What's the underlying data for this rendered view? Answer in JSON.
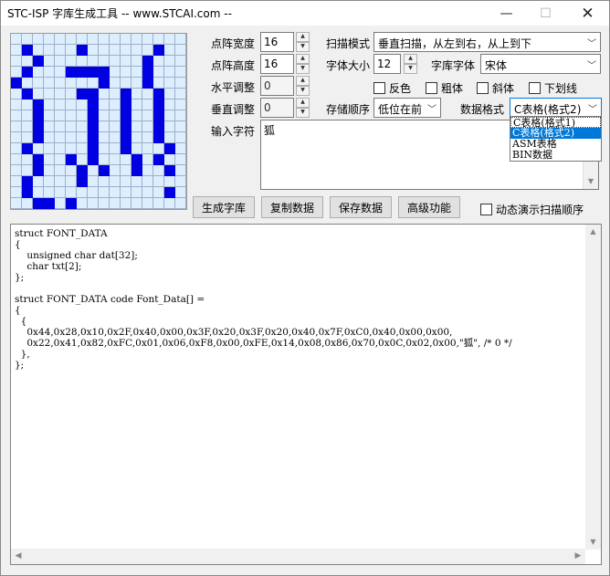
{
  "window": {
    "title": "STC-ISP 字库生成工具 -- www.STCAI.com --",
    "min_glyph": "—",
    "max_glyph": "☐",
    "close_glyph": "✕"
  },
  "matrix": {
    "rows": [
      "0000000000000000",
      "0100001000000100",
      "0010000000001000",
      "0100011110001000",
      "1000000010001000",
      "0100001100100100",
      "0010000100100100",
      "0010000100100100",
      "0010000100100100",
      "0010000100100100",
      "0100000100100010",
      "0010010100010100",
      "0010001010010010",
      "0100001000000000",
      "0100000000000010",
      "0011010000000000"
    ]
  },
  "controls": {
    "dot_width_label": "点阵宽度",
    "dot_width_value": "16",
    "dot_height_label": "点阵高度",
    "dot_height_value": "16",
    "h_adjust_label": "水平调整",
    "h_adjust_value": "0",
    "v_adjust_label": "垂直调整",
    "v_adjust_value": "0",
    "scan_mode_label": "扫描模式",
    "scan_mode_value": "垂直扫描，从左到右，从上到下",
    "font_size_label": "字体大小",
    "font_size_value": "12",
    "font_label": "字库字体",
    "font_value": "宋体",
    "invert_label": "反色",
    "bold_label": "粗体",
    "italic_label": "斜体",
    "underline_label": "下划线",
    "storage_order_label": "存储顺序",
    "storage_order_value": "低位在前",
    "data_format_label": "数据格式",
    "data_format_value": "C表格(格式2)",
    "input_label": "输入字符",
    "input_value": "狐",
    "dropdown_options": [
      "C表格(格式1)",
      "C表格(格式2)",
      "ASM表格",
      "BIN数据"
    ]
  },
  "buttons": {
    "generate": "生成字库",
    "copy": "复制数据",
    "save": "保存数据",
    "advanced": "高级功能",
    "demo_label": "动态演示扫描顺序"
  },
  "code_lines": [
    "struct FONT_DATA",
    "{",
    "    unsigned char dat[32];",
    "    char txt[2];",
    "};",
    "",
    "struct FONT_DATA code Font_Data[] =",
    "{",
    "  {",
    "    0x44,0x28,0x10,0x2F,0x40,0x00,0x3F,0x20,0x3F,0x20,0x40,0x7F,0xC0,0x40,0x00,0x00,",
    "    0x22,0x41,0x82,0xFC,0x01,0x06,0xF8,0x00,0xFE,0x14,0x08,0x86,0x70,0x0C,0x02,0x00,\"狐\", /* 0 */",
    "  },",
    "};"
  ]
}
